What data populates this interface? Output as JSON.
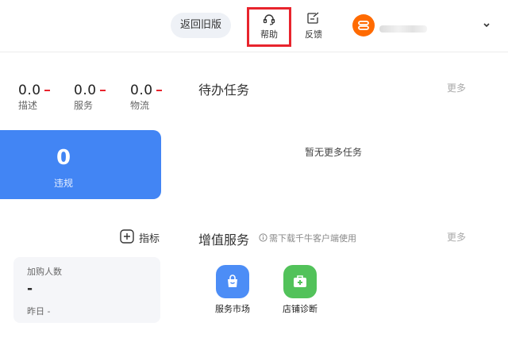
{
  "header": {
    "old_version_label": "返回旧版",
    "help_label": "帮助",
    "feedback_label": "反馈"
  },
  "scores": [
    {
      "value": "0.0",
      "label": "描述"
    },
    {
      "value": "0.0",
      "label": "服务"
    },
    {
      "value": "0.0",
      "label": "物流"
    }
  ],
  "violation": {
    "count": "0",
    "label": "违规"
  },
  "metrics_button_label": "指标",
  "cart_card": {
    "title": "加购人数",
    "value": "-",
    "yesterday": "昨日 -"
  },
  "todo": {
    "title": "待办任务",
    "more": "更多",
    "empty_text": "暂无更多任务"
  },
  "value_added": {
    "title": "增值服务",
    "note": "需下载千牛客户端使用",
    "more": "更多",
    "services": [
      {
        "label": "服务市场",
        "icon": "shopping-bag-icon",
        "color": "#4c8df6"
      },
      {
        "label": "店铺诊断",
        "icon": "medical-kit-icon",
        "color": "#52c25a"
      }
    ]
  },
  "colors": {
    "accent": "#4285f4",
    "highlight": "#e8242d",
    "avatar": "#ff6a00"
  }
}
